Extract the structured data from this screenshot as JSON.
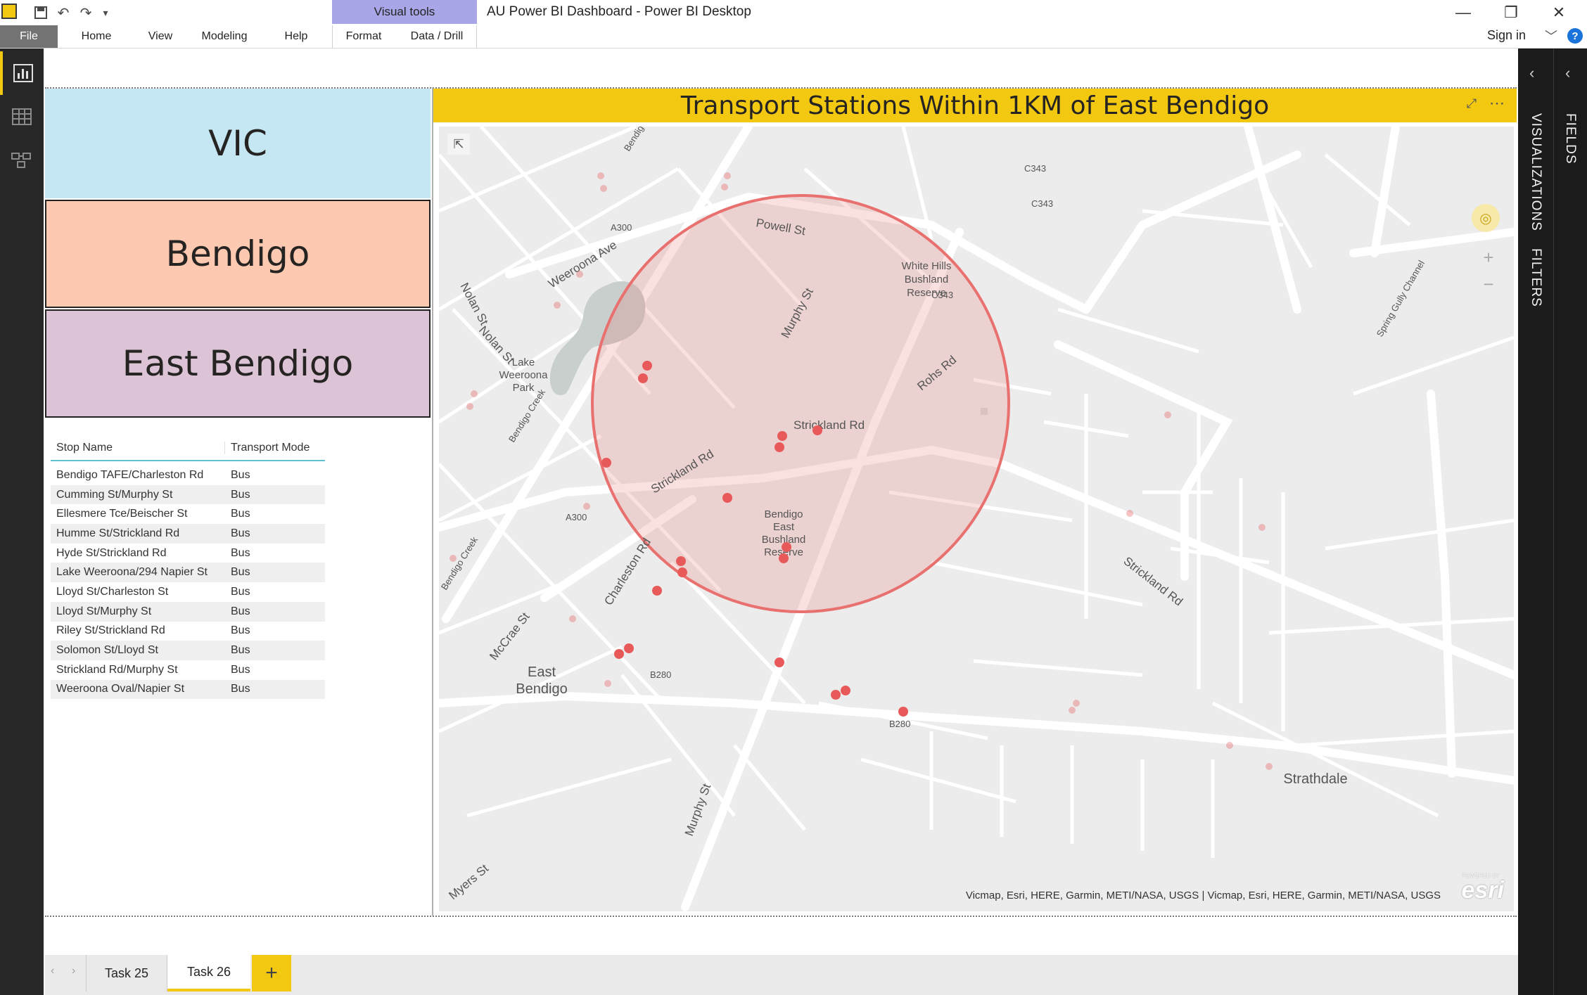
{
  "titlebar": {
    "window_title": "AU Power BI Dashboard - Power BI Desktop",
    "contextual_group": "Visual tools",
    "minimize": "—",
    "restore": "❐",
    "close": "✕"
  },
  "ribbon": {
    "tabs": [
      "File",
      "Home",
      "View",
      "Modeling",
      "Help",
      "Format",
      "Data / Drill"
    ],
    "sign_in": "Sign in",
    "help": "?"
  },
  "side_panes": {
    "visualizations": "VISUALIZATIONS",
    "filters": "FILTERS",
    "fields": "FIELDS"
  },
  "cards": {
    "state": "VIC",
    "city": "Bendigo",
    "suburb": "East Bendigo"
  },
  "table": {
    "headers": [
      "Stop Name",
      "Transport Mode"
    ],
    "rows": [
      [
        "Bendigo TAFE/Charleston Rd",
        "Bus"
      ],
      [
        "Cumming St/Murphy St",
        "Bus"
      ],
      [
        "Ellesmere Tce/Beischer St",
        "Bus"
      ],
      [
        "Humme St/Strickland Rd",
        "Bus"
      ],
      [
        "Hyde St/Strickland Rd",
        "Bus"
      ],
      [
        "Lake Weeroona/294 Napier St",
        "Bus"
      ],
      [
        "Lloyd St/Charleston St",
        "Bus"
      ],
      [
        "Lloyd St/Murphy St",
        "Bus"
      ],
      [
        "Riley St/Strickland Rd",
        "Bus"
      ],
      [
        "Solomon St/Lloyd St",
        "Bus"
      ],
      [
        "Strickland Rd/Murphy St",
        "Bus"
      ],
      [
        "Weeroona Oval/Napier St",
        "Bus"
      ]
    ]
  },
  "map": {
    "title": "Transport Stations Within 1KM of East Bendigo",
    "attribution": "Vicmap, Esri, HERE, Garmin, METI/NASA, USGS | Vicmap, Esri, HERE, Garmin, METI/NASA, USGS",
    "logo": "esri",
    "logo_small": "POWERED BY",
    "labels": {
      "powell": "Powell St",
      "white_hills": "White Hills",
      "bushland": "Bushland",
      "reserve": "Reserve",
      "c343": "C343",
      "a300": "A300",
      "weeroona_ave": "Weeroona Ave",
      "nolan": "Nolan St",
      "murphy": "Murphy St",
      "rohs": "Rohs Rd",
      "lake": "Lake",
      "weeroona": "Weeroona",
      "park": "Park",
      "strickland": "Strickland Rd",
      "bendigo_creek": "Bendigo Creek",
      "bendigo": "Bendigo",
      "east": "East",
      "charleston": "Charleston Rd",
      "mccrae": "McCrae St",
      "b280": "B280",
      "strathdale": "Strathdale",
      "myers": "Myers St",
      "spring_gully": "Spring Gully Channel"
    }
  },
  "pages": {
    "tabs": [
      "Task 25",
      "Task 26"
    ],
    "add": "+"
  },
  "colors": {
    "accent": "#F2C811",
    "card_state": "#C5E7F3",
    "card_city": "#FDC9B0",
    "card_suburb": "#DCC4D6",
    "circle": "#E8706E",
    "marker": "#E85A5A"
  }
}
